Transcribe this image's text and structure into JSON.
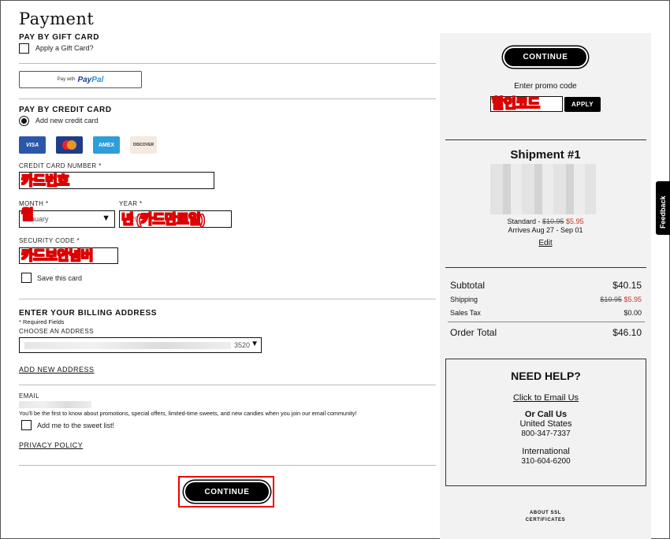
{
  "page": {
    "title": "Payment"
  },
  "gift_card": {
    "heading": "PAY BY GIFT CARD",
    "apply_label": "Apply a Gift Card?"
  },
  "paypal": {
    "prefix": "Pay with",
    "brand_a": "Pay",
    "brand_b": "Pal"
  },
  "credit_card": {
    "heading": "PAY BY CREDIT CARD",
    "add_new_label": "Add new credit card",
    "cards": [
      {
        "name": "VISA",
        "color": "#2a57a8"
      },
      {
        "name": "mastercard",
        "color": "#1f3b8a"
      },
      {
        "name": "AMEX",
        "color": "#2e9ed8"
      },
      {
        "name": "DISCOVER",
        "color": "#f6e9df"
      }
    ],
    "number_label": "CREDIT CARD NUMBER *",
    "number_overlay": "카드번호",
    "month_label": "MONTH *",
    "month_value": "nuary",
    "month_overlay": "월",
    "year_label": "YEAR *",
    "year_value": "20",
    "year_overlay": "년 (카드만료일)",
    "security_label": "SECURITY CODE *",
    "security_overlay": "카드보안넘버",
    "save_label": "Save this card"
  },
  "billing": {
    "heading": "ENTER YOUR BILLING ADDRESS",
    "required_note": "* Required Fields",
    "choose_label": "CHOOSE AN ADDRESS",
    "address_suffix": "3520",
    "add_new": "ADD NEW ADDRESS"
  },
  "email": {
    "label": "EMAIL",
    "promo_text": "You'll be the first to know about promotions, special offers, limited-time sweets, and new candies when you join our email community!",
    "sweet_list_label": "Add me to the sweet list!",
    "privacy": "PRIVACY POLICY"
  },
  "continue_label": "CONTINUE",
  "sidebar": {
    "continue_label": "CONTINUE",
    "promo_label": "Enter promo code",
    "promo_overlay": "할인코드",
    "apply_label": "APPLY",
    "shipment_title": "Shipment #1",
    "shipping_prefix": "Standard -",
    "shipping_old": "$10.95",
    "shipping_new": "$5.95",
    "arrives": "Arrives Aug 27 - Sep 01",
    "edit": "Edit",
    "subtotal_label": "Subtotal",
    "subtotal_value": "$40.15",
    "shipping_label": "Shipping",
    "shipping_old_value": "$10.95",
    "shipping_new_value": "$5.95",
    "tax_label": "Sales Tax",
    "tax_value": "$0.00",
    "total_label": "Order Total",
    "total_value": "$46.10",
    "help_title": "NEED HELP?",
    "email_us": "Click to Email Us",
    "or_call": "Or Call Us",
    "us_label": "United States",
    "us_phone": "800-347-7337",
    "intl_label": "International",
    "intl_phone": "310-604-6200",
    "ssl_line1": "ABOUT SSL",
    "ssl_line2": "CERTIFICATES"
  },
  "feedback": {
    "label": "Feedback"
  },
  "colors": {
    "sale_red": "#c0392b",
    "highlight_red": "#d00000"
  }
}
